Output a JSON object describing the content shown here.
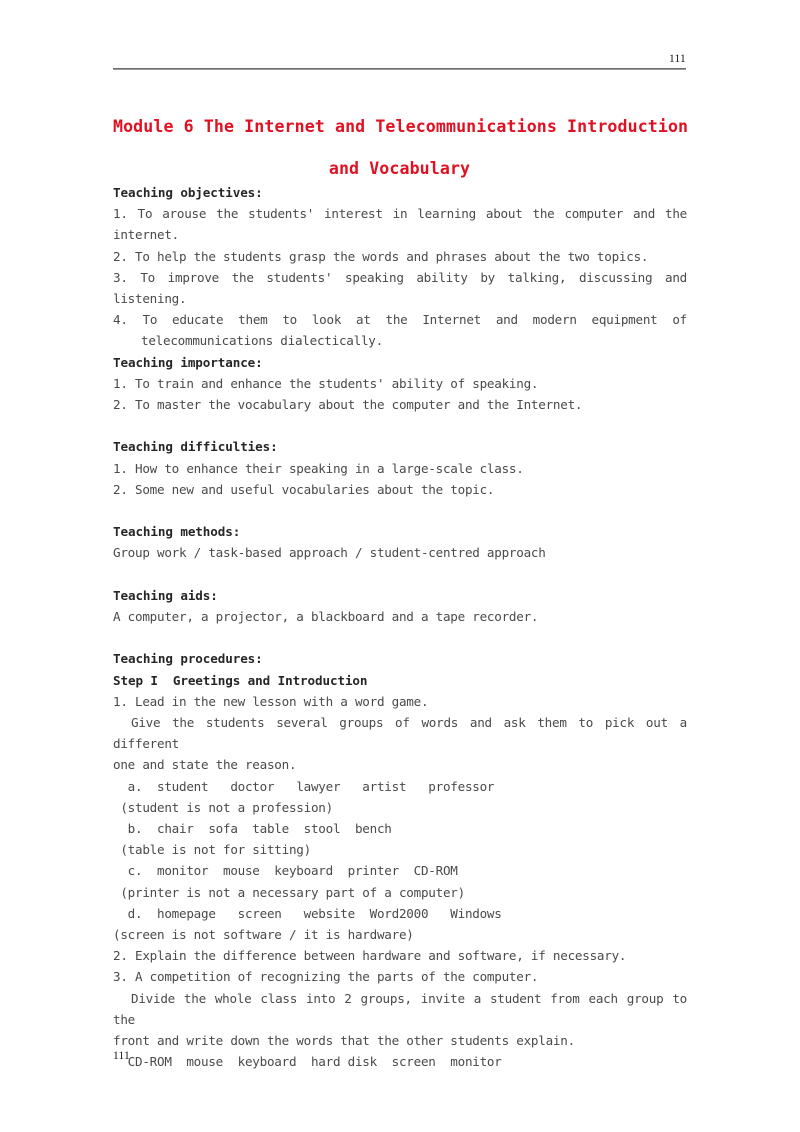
{
  "header": {
    "page_number": "111"
  },
  "title": {
    "line1": "Module 6 The Internet and Telecommunications Introduction",
    "line2": "and Vocabulary"
  },
  "footer": {
    "page_number": "111"
  },
  "sections": {
    "objectives": {
      "heading": "Teaching objectives:",
      "item1": "1. To arouse the students' interest in learning about the computer and the",
      "item1_cont": "internet.",
      "item2": "2. To help the students grasp the words and phrases about the two topics.",
      "item3": "3. To improve the students' speaking ability by talking, discussing and",
      "item3_cont": "listening.",
      "item4": "4. To educate them to look at the Internet and modern equipment of",
      "item4_cont": "telecommunications dialectically."
    },
    "importance": {
      "heading": "Teaching importance:",
      "item1": "1. To train and enhance the students' ability of speaking.",
      "item2": "2. To master the vocabulary about the computer and the Internet."
    },
    "difficulties": {
      "heading": "Teaching difficulties:",
      "item1": "1. How to enhance their speaking in a large-scale class.",
      "item2": "2. Some new and useful vocabularies about the topic."
    },
    "methods": {
      "heading": "Teaching methods:",
      "body": "Group work / task-based approach / student-centred approach"
    },
    "aids": {
      "heading": "Teaching aids:",
      "body": "A computer, a projector, a blackboard and a tape recorder."
    },
    "procedures": {
      "heading": "Teaching procedures:",
      "step1_heading": "Step I  Greetings and Introduction",
      "p1": "1. Lead in the new lesson with a word game.",
      "p1_body_a": "Give the students several groups of words and ask them to pick out a different",
      "p1_body_b": "one and state the reason.",
      "group_a": "  a.  student   doctor   lawyer   artist   professor",
      "answer_a": " (student is not a profession)",
      "group_b": "  b.  chair  sofa  table  stool  bench",
      "answer_b": " (table is not for sitting)",
      "group_c": "  c.  monitor  mouse  keyboard  printer  CD-ROM",
      "answer_c": " (printer is not a necessary part of a computer)",
      "group_d": "  d.  homepage   screen   website  Word2000   Windows",
      "answer_d": "(screen is not software / it is hardware)",
      "p2": "2. Explain the difference between hardware and software, if necessary.",
      "p3": "3. A competition of recognizing the parts of the computer.",
      "p3_body_a": "Divide the whole class into 2 groups, invite a student from each group to the",
      "p3_body_b": "front and write down the words that the other students explain.",
      "word_list": "  CD-ROM  mouse  keyboard  hard disk  screen  monitor"
    }
  }
}
